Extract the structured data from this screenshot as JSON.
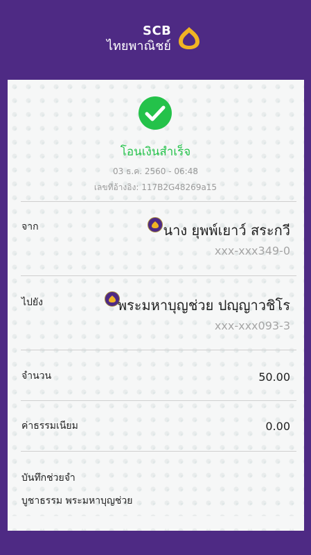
{
  "header": {
    "logo_en": "SCB",
    "logo_th": "ไทยพาณิชย์",
    "background": "#4e2a84",
    "accent": "#f0b323"
  },
  "receipt": {
    "status": "โอนเงินสำเร็จ",
    "status_color": "#24c24a",
    "datetime": "03 ธ.ค. 2560 - 06:48",
    "reference": "เลขที่อ้างอิง: 117B2G48269a15",
    "from": {
      "label": "จาก",
      "name": "นาง ยุพพ์เยาว์ สระกวี",
      "account": "xxx-xxx349-0",
      "bank_icon": "scb-logo-icon"
    },
    "to": {
      "label": "ไปยัง",
      "name": "พระมหาบุญช่วย ปญฺญาวชิโร",
      "account": "xxx-xxx093-3",
      "bank_icon": "scb-logo-icon"
    },
    "amount": {
      "label": "จำนวน",
      "value": "50.00"
    },
    "fee": {
      "label": "ค่าธรรมเนียม",
      "value": "0.00"
    },
    "memo": {
      "label": "บันทึกช่วยจำ",
      "value": "บูชาธรรม พระมหาบุญช่วย"
    }
  }
}
